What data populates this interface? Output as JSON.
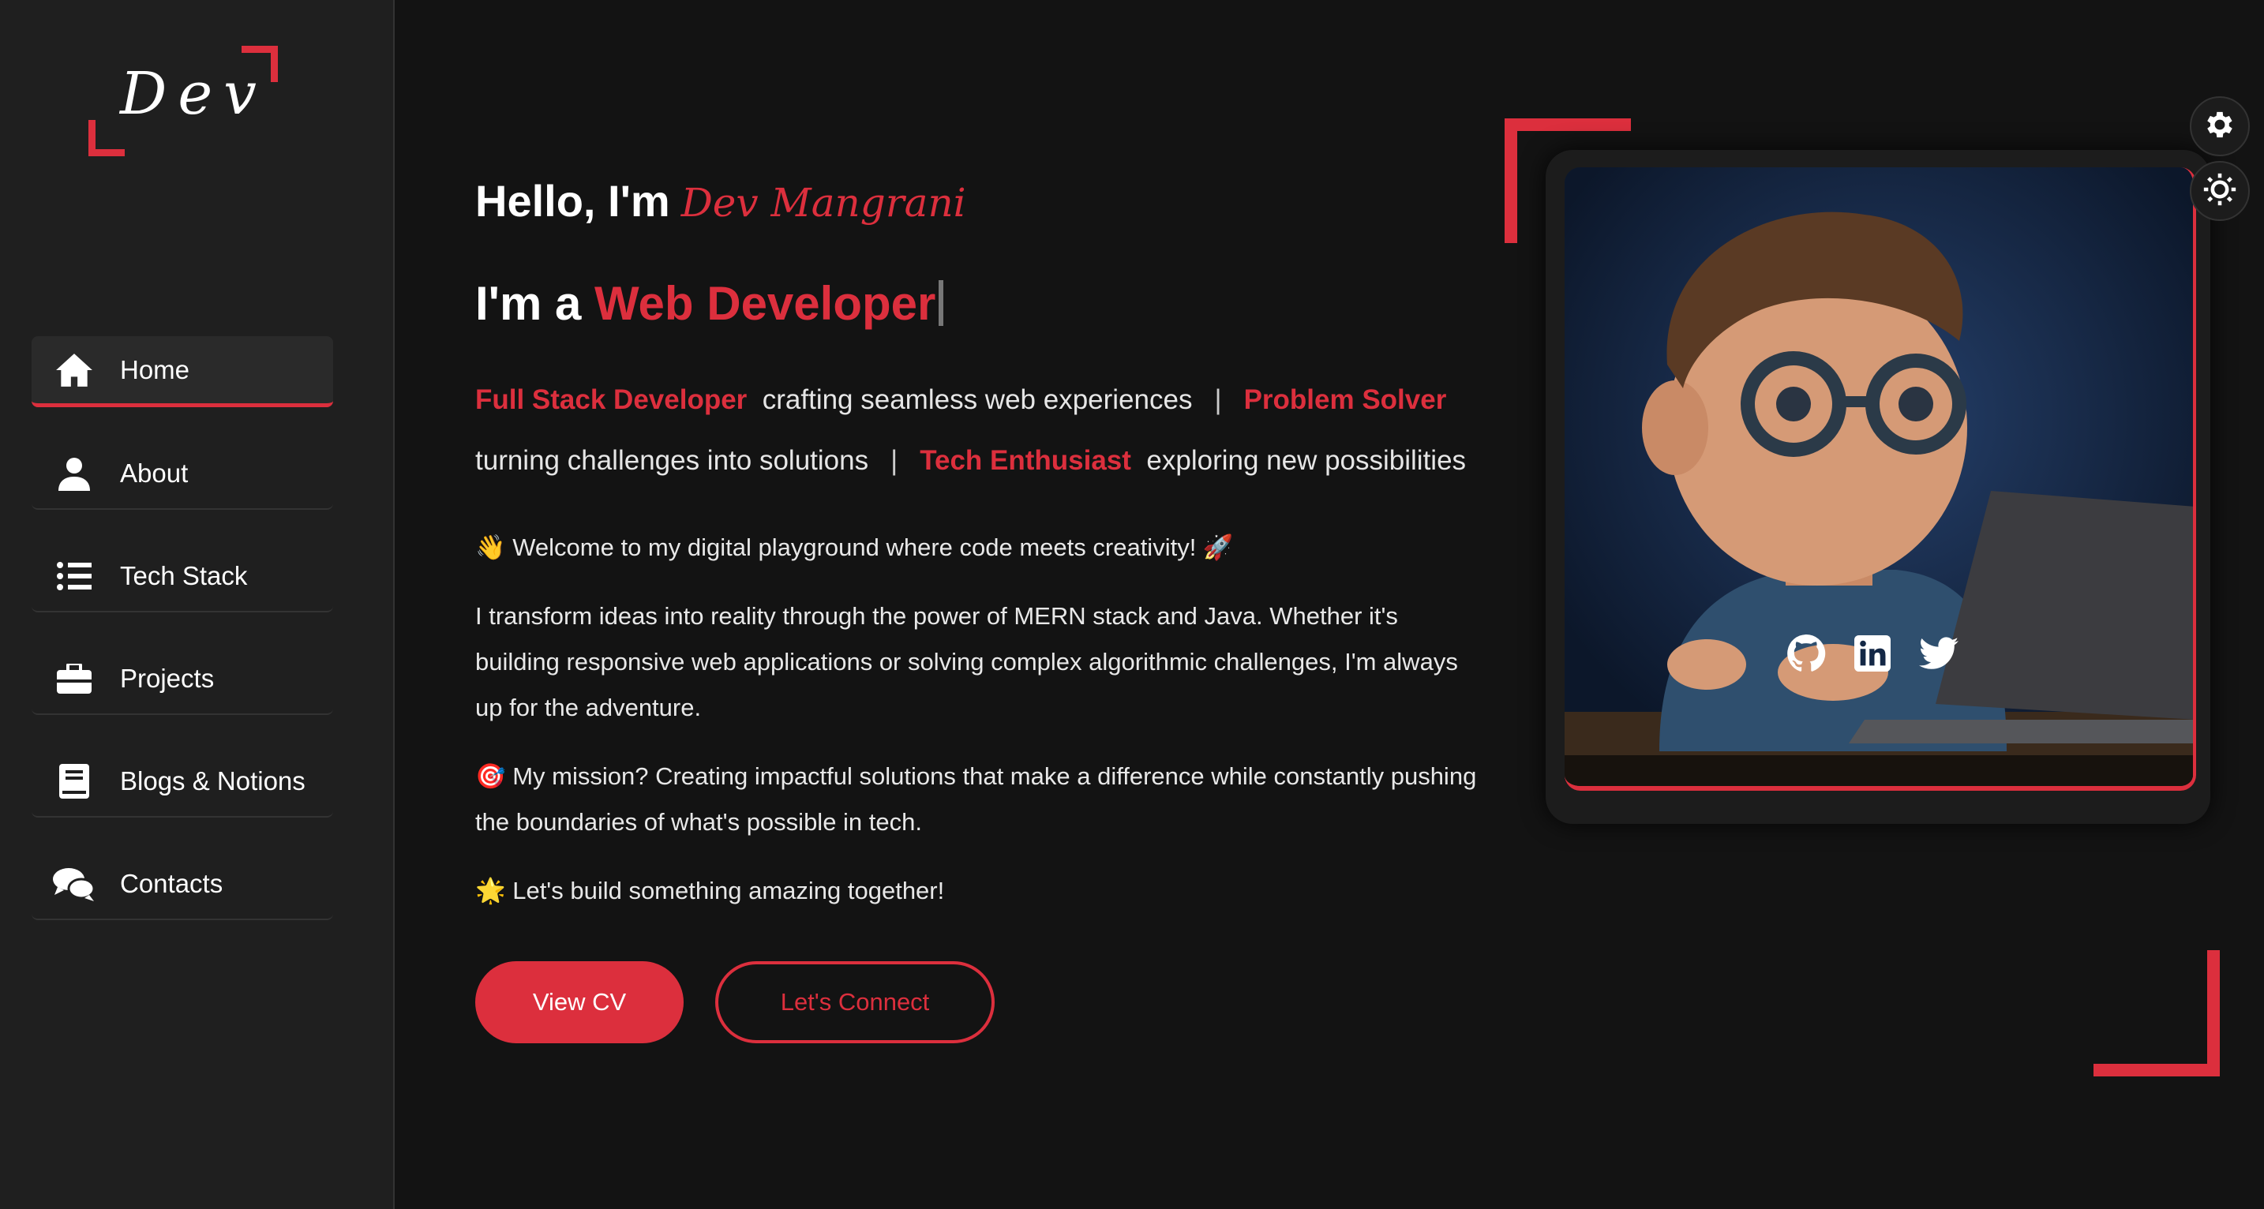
{
  "logo": {
    "text": "Dev"
  },
  "sidebar": {
    "items": [
      {
        "label": "Home",
        "icon": "home-icon",
        "active": true
      },
      {
        "label": "About",
        "icon": "user-icon"
      },
      {
        "label": "Tech Stack",
        "icon": "list-icon"
      },
      {
        "label": "Projects",
        "icon": "briefcase-icon"
      },
      {
        "label": "Blogs & Notions",
        "icon": "book-icon"
      },
      {
        "label": "Contacts",
        "icon": "chat-icon"
      }
    ]
  },
  "hero": {
    "greeting": "Hello, I'm",
    "name": "Dev Mangrani",
    "role_prefix": "I'm a",
    "role": "Web Developer",
    "tags": [
      {
        "highlight": "Full Stack Developer",
        "text": "crafting seamless web experiences"
      },
      {
        "highlight": "Problem Solver",
        "text": "turning challenges into solutions"
      },
      {
        "highlight": "Tech Enthusiast",
        "text": "exploring new possibilities"
      }
    ],
    "separator": "|",
    "welcome": "👋 Welcome to my digital playground where code meets creativity! 🚀",
    "intro": "I transform ideas into reality through the power of MERN stack and Java. Whether it's building responsive web applications or solving complex algorithmic challenges, I'm always up for the adventure.",
    "mission": "🎯 My mission? Creating impactful solutions that make a difference while constantly pushing the boundaries of what's possible in tech.",
    "closing": "🌟 Let's build something amazing together!",
    "cv_button": "View CV",
    "connect_button": "Let's Connect"
  },
  "socials": [
    {
      "icon": "github-icon"
    },
    {
      "icon": "linkedin-icon"
    },
    {
      "icon": "twitter-icon"
    }
  ],
  "floating": [
    {
      "icon": "settings-icon"
    },
    {
      "icon": "theme-sun-icon"
    }
  ],
  "colors": {
    "accent": "#dc2f3d",
    "background": "#131313",
    "sidebar": "#1f1f1f"
  }
}
